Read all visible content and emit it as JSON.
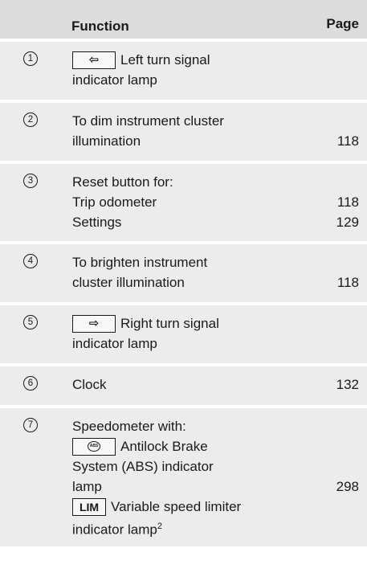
{
  "header": {
    "function": "Function",
    "page": "Page"
  },
  "rows": [
    {
      "num": "1",
      "key": "⇦",
      "lines": [
        "Left turn signal",
        "indicator lamp"
      ]
    },
    {
      "num": "2",
      "lines": [
        "To dim instrument cluster",
        "illumination"
      ],
      "page": "118"
    },
    {
      "num": "3",
      "lines": [
        "Reset button for:",
        "Trip odometer",
        "Settings"
      ],
      "pages": [
        "118",
        "129"
      ]
    },
    {
      "num": "4",
      "lines": [
        "To brighten instrument",
        "cluster illumination"
      ],
      "page": "118"
    },
    {
      "num": "5",
      "key": "⇨",
      "lines": [
        "Right turn signal",
        "indicator lamp"
      ]
    },
    {
      "num": "6",
      "lines": [
        "Clock"
      ],
      "page": "132"
    },
    {
      "num": "7",
      "lines": [
        "Speedometer with:",
        "Antilock Brake",
        "System (ABS) indicator",
        "lamp",
        "Variable speed limiter",
        "indicator lamp"
      ],
      "abs_key": "ABS",
      "lim_key": "LIM",
      "footnote": "2",
      "page": "298"
    }
  ]
}
